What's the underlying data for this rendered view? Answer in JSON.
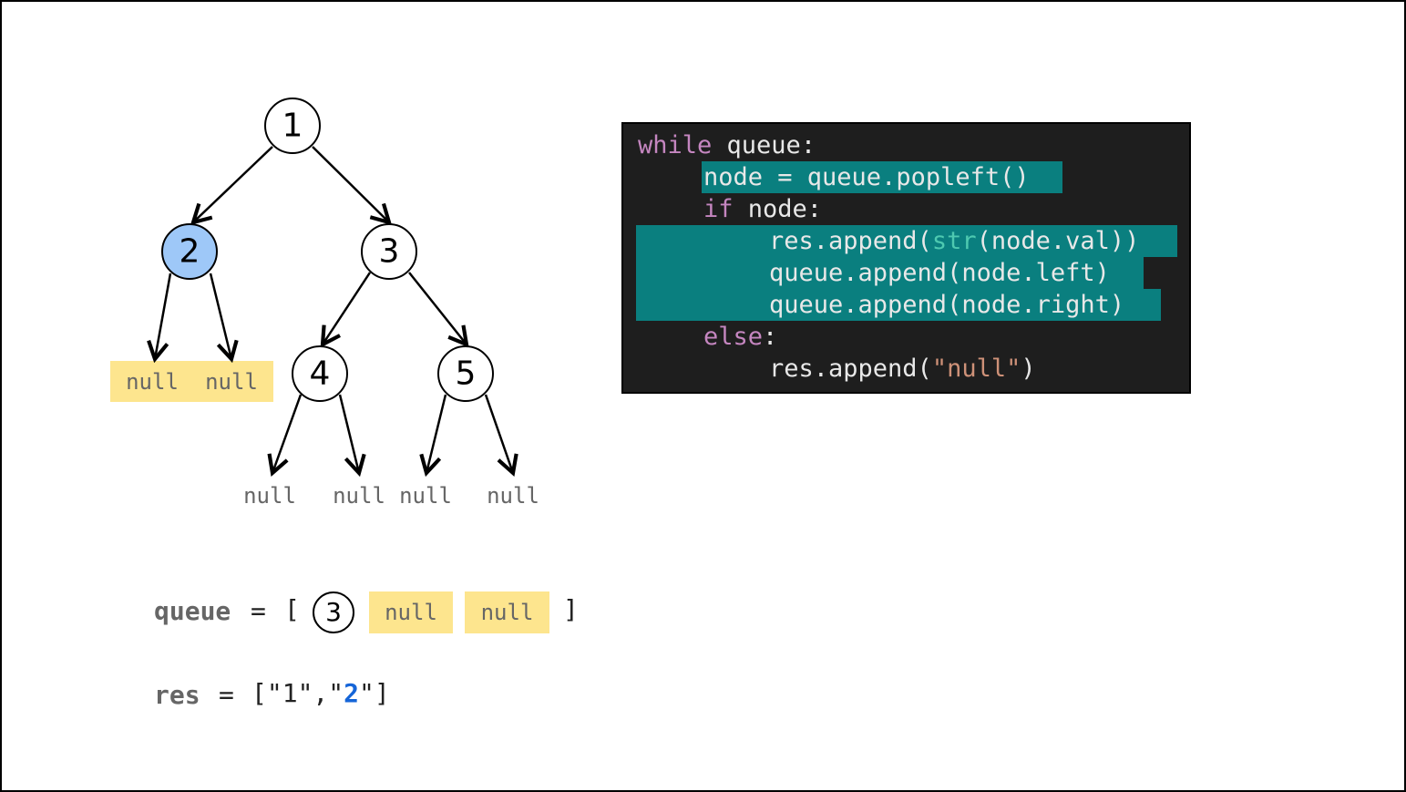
{
  "tree": {
    "nodes": [
      {
        "id": "n1",
        "label": "1",
        "active": false
      },
      {
        "id": "n2",
        "label": "2",
        "active": true
      },
      {
        "id": "n3",
        "label": "3",
        "active": false
      },
      {
        "id": "n4",
        "label": "4",
        "active": false
      },
      {
        "id": "n5",
        "label": "5",
        "active": false
      }
    ],
    "null_label": "null"
  },
  "code": {
    "l1_kw": "while",
    "l1_rest": " queue:",
    "l2": "node = queue.popleft()",
    "l3_kw": "if",
    "l3_rest": " node:",
    "l4_a": "res.append(",
    "l4_b": "str",
    "l4_c": "(node.val))",
    "l5": "queue.append(node.left)",
    "l6": "queue.append(node.right)",
    "l7_kw": "else",
    "l7_rest": ":",
    "l8_a": "res.append(",
    "l8_b": "\"null\"",
    "l8_c": ")"
  },
  "queue": {
    "label": "queue",
    "eq": "=",
    "open": "[",
    "close": "]",
    "items": [
      "3",
      "null",
      "null"
    ]
  },
  "res": {
    "label": "res",
    "eq": "=",
    "prefix": "[\"1\",\"",
    "current": "2",
    "suffix": "\"]"
  },
  "colors": {
    "active_node": "#9ec8f8",
    "highlight_chip": "#fde58e",
    "code_highlight": "#0a7f7f",
    "code_bg": "#1e1e1e",
    "current_value": "#1565d8"
  }
}
